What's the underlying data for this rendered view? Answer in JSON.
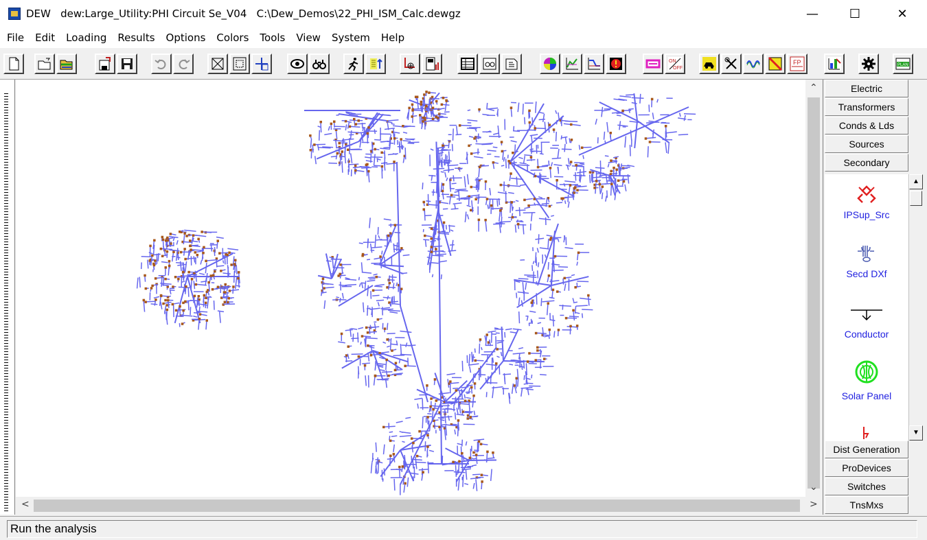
{
  "window": {
    "app_name": "DEW",
    "title": "DEW   dew:Large_Utility:PHI Circuit Se_V04   C:\\Dew_Demos\\22_PHI_ISM_Calc.dewgz",
    "minimize_glyph": "—",
    "maximize_glyph": "☐",
    "close_glyph": "✕"
  },
  "menu": [
    "File",
    "Edit",
    "Loading",
    "Results",
    "Options",
    "Colors",
    "Tools",
    "View",
    "System",
    "Help"
  ],
  "toolbar": {
    "buttons": [
      "new-icon",
      "open-icon",
      "open-folder-icon",
      "save-as-icon",
      "save-icon",
      "undo-icon",
      "redo-icon",
      "zoom-fit-icon",
      "zoom-window-icon",
      "pan-icon",
      "view-eye-icon",
      "binoculars-icon",
      "run-icon",
      "results-up-icon",
      "add-circuit-icon",
      "meter-icon",
      "table-icon",
      "glasses-icon",
      "report-icon",
      "color-wheel-icon",
      "graph-icon",
      "graph2-icon",
      "alert-icon",
      "switch-icon",
      "on-off-icon",
      "car-icon",
      "tools-icon",
      "wave-icon",
      "cut-icon",
      "fp-icon",
      "chart-map-icon",
      "gear-icon",
      "plan-icon"
    ]
  },
  "canvas": {
    "line_color": "#6666ee",
    "node_color": "#a8581a"
  },
  "palette": {
    "tabs_top": [
      "Electric",
      "Transformers",
      "Conds & Lds",
      "Sources",
      "Secondary"
    ],
    "items": [
      {
        "label": "IPSup_Src",
        "icon": "ipsup-src-icon"
      },
      {
        "label": "Secd DXf",
        "icon": "secd-dxf-icon"
      },
      {
        "label": "Conductor",
        "icon": "conductor-icon"
      },
      {
        "label": "Solar Panel",
        "icon": "solar-panel-icon"
      }
    ],
    "tabs_bottom": [
      "Dist Generation",
      "ProDevices",
      "Switches",
      "TnsMxs"
    ]
  },
  "status": {
    "message": "Run the analysis"
  }
}
